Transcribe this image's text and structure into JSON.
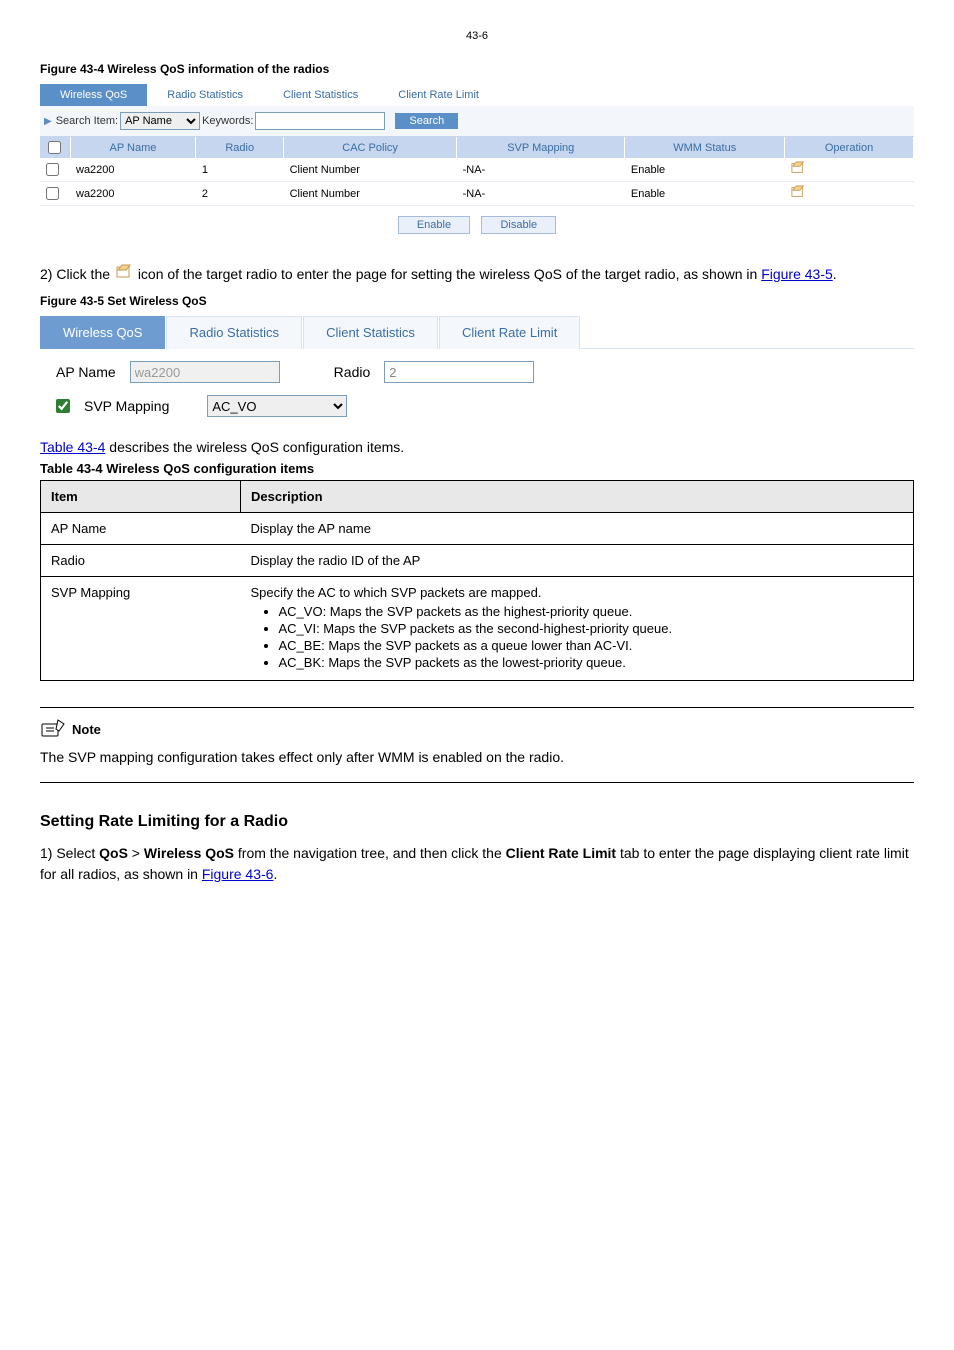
{
  "page_number": "43-6",
  "fig1_caption": "Figure 43-4 Wireless QoS information of the radios",
  "tabs1": {
    "t0": "Wireless QoS",
    "t1": "Radio Statistics",
    "t2": "Client Statistics",
    "t3": "Client Rate Limit"
  },
  "searchbar": {
    "label_item": "Search Item:",
    "select_value": "AP Name",
    "label_kw": "Keywords:",
    "btn": "Search"
  },
  "grid_headers": {
    "c0": "AP Name",
    "c1": "Radio",
    "c2": "CAC Policy",
    "c3": "SVP Mapping",
    "c4": "WMM Status",
    "c5": "Operation"
  },
  "grid_rows": [
    {
      "ap": "wa2200",
      "radio": "1",
      "cac": "Client Number",
      "svp": "-NA-",
      "wmm": "Enable"
    },
    {
      "ap": "wa2200",
      "radio": "2",
      "cac": "Client Number",
      "svp": "-NA-",
      "wmm": "Enable"
    }
  ],
  "btnrow": {
    "enable": "Enable",
    "disable": "Disable"
  },
  "para1_pre": "2) Click the ",
  "para1_post": " icon of the target radio to enter the page for setting the wireless QoS of the target radio, as shown in ",
  "para1_link": "Figure 43-5",
  "para1_end": ".",
  "fig2_caption": "Figure 43-5 Set Wireless QoS",
  "tabs2": {
    "t0": "Wireless QoS",
    "t1": "Radio Statistics",
    "t2": "Client Statistics",
    "t3": "Client Rate Limit"
  },
  "form2": {
    "apname_label": "AP Name",
    "apname_value": "wa2200",
    "radio_label": "Radio",
    "radio_value": "2",
    "svp_label": "SVP Mapping",
    "svp_select": "AC_VO"
  },
  "desc_intro_link": "Table 43-4",
  "desc_intro_rest": " describes the wireless QoS configuration items.",
  "table_title": "Table 43-4 Wireless QoS configuration items",
  "desc_th0": "Item",
  "desc_th1": "Description",
  "desc_r0_c0": "AP Name",
  "desc_r0_c1": "Display the AP name",
  "desc_r1_c0": "Radio",
  "desc_r1_c1": "Display the radio ID of the AP",
  "desc_r2_c0": "SVP Mapping",
  "desc_r2_c1_intro": "Specify the AC to which SVP packets are mapped.",
  "desc_r2_li0": "AC_VO: Maps the SVP packets as the highest-priority queue.",
  "desc_r2_li1": "AC_VI: Maps the SVP packets as the second-highest-priority queue.",
  "desc_r2_li2": "AC_BE: Maps the SVP packets as a queue lower than AC-VI.",
  "desc_r2_li3": "AC_BK: Maps the SVP packets as the lowest-priority queue.",
  "note_title": "Note",
  "note_body": "The SVP mapping configuration takes effect only after WMM is enabled on the radio.",
  "section_heading": "Setting Rate Limiting for a Radio",
  "step1_a": "1) Select ",
  "step1_b": "QoS",
  "step1_c": " > ",
  "step1_d": "Wireless QoS",
  "step1_e": " from the navigation tree, and then click the ",
  "step1_f": "Client Rate Limit",
  "step1_g": " tab to enter the page displaying client rate limit for all radios, as shown in ",
  "step1_link": "Figure 43-6",
  "step1_end": "."
}
